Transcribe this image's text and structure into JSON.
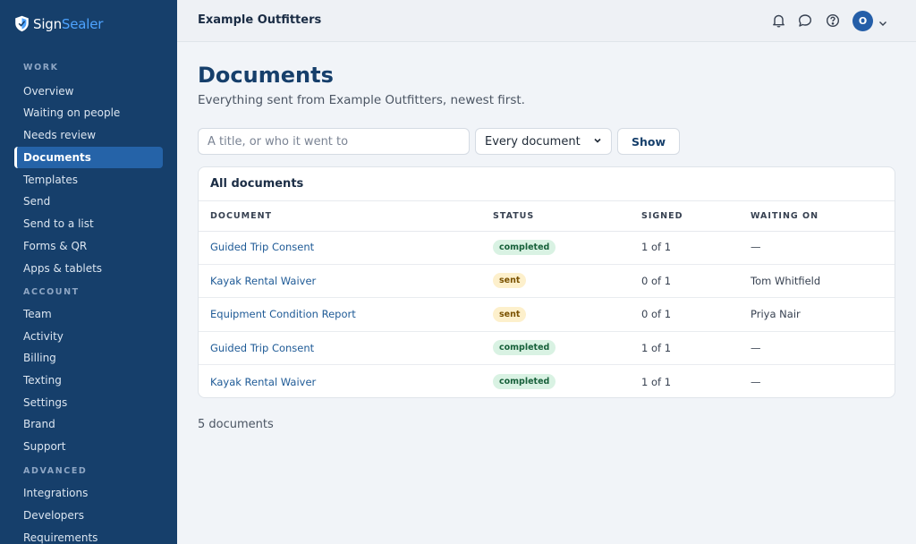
{
  "brand": {
    "name_part1": "Sign",
    "name_part2": "Sealer",
    "accent": "#4da3ff"
  },
  "sidebar": {
    "sections": [
      {
        "label": "WORK",
        "items": [
          "Overview",
          "Waiting on people",
          "Needs review",
          "Documents",
          "Templates",
          "Send",
          "Send to a list",
          "Forms & QR",
          "Apps & tablets"
        ]
      },
      {
        "label": "ACCOUNT",
        "items": [
          "Team",
          "Activity",
          "Billing",
          "Texting",
          "Settings",
          "Brand",
          "Support"
        ]
      },
      {
        "label": "ADVANCED",
        "items": [
          "Integrations",
          "Developers",
          "Requirements"
        ]
      }
    ],
    "active_item": "Documents"
  },
  "topbar": {
    "org_name": "Example Outfitters",
    "icons": [
      "bell-icon",
      "chat-icon",
      "help-icon"
    ],
    "avatar_initial": "O"
  },
  "main": {
    "title": "Documents",
    "subtitle": "Everything sent from Example Outfitters, newest first.",
    "search": {
      "placeholder": "A title, or who it went to",
      "value": ""
    },
    "filter": {
      "selected": "Every document"
    },
    "show_label": "Show",
    "table": {
      "title": "All documents",
      "columns": [
        "DOCUMENT",
        "STATUS",
        "SIGNED",
        "WAITING ON"
      ],
      "rows": [
        {
          "document": "Guided Trip Consent",
          "status": "completed",
          "signed": "1 of 1",
          "waiting_on": "—"
        },
        {
          "document": "Kayak Rental Waiver",
          "status": "sent",
          "signed": "0 of 1",
          "waiting_on": "Tom Whitfield"
        },
        {
          "document": "Equipment Condition Report",
          "status": "sent",
          "signed": "0 of 1",
          "waiting_on": "Priya Nair"
        },
        {
          "document": "Guided Trip Consent",
          "status": "completed",
          "signed": "1 of 1",
          "waiting_on": "—"
        },
        {
          "document": "Kayak Rental Waiver",
          "status": "completed",
          "signed": "1 of 1",
          "waiting_on": "—"
        }
      ]
    },
    "count_label": "5 documents"
  },
  "colors": {
    "sidebar_bg": "#163f6b",
    "active_bg": "#2563a8",
    "completed_bg": "#d9f2e3",
    "sent_bg": "#fdf0cc"
  }
}
